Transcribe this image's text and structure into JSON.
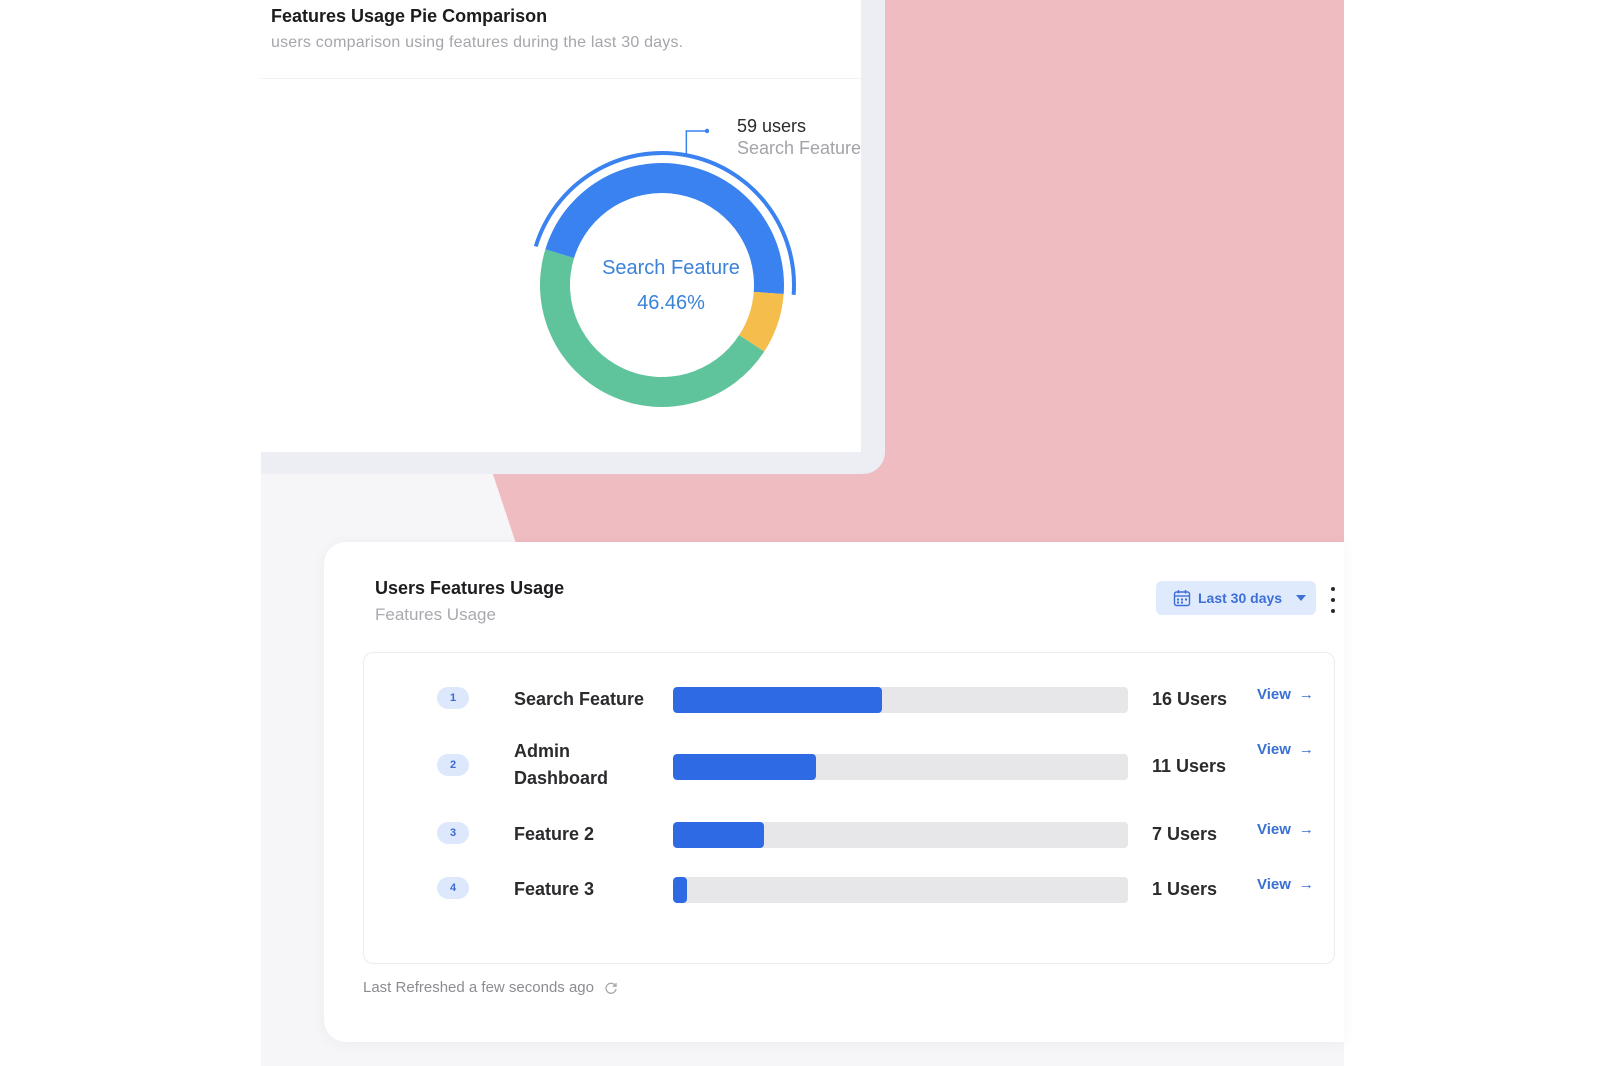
{
  "pie_card": {
    "title": "Features Usage Pie Comparison",
    "subtitle": "users comparison using features during the last 30 days.",
    "callout_value": "59 users",
    "callout_label": "Search Feature",
    "center_name": "Search Feature",
    "center_percent": "46.46%"
  },
  "chart_data": {
    "type": "pie",
    "variant": "donut",
    "highlighted": "Search Feature",
    "slices": [
      {
        "label": "Search Feature",
        "value": 46.46,
        "color": "#3a82f0"
      },
      {
        "label": "",
        "value": 8.0,
        "color": "#f5bd4b"
      },
      {
        "label": "",
        "value": 45.54,
        "color": "#5fc49b"
      }
    ]
  },
  "usage_card": {
    "title": "Users Features Usage",
    "subtitle": "Features Usage",
    "range_label": "Last 30 days",
    "refreshed": "Last Refreshed a few seconds ago",
    "view_label": "View",
    "rows": [
      {
        "rank": "1",
        "name": "Search Feature",
        "count": "16 Users",
        "fraction": 0.46
      },
      {
        "rank": "2",
        "name": "Admin Dashboard",
        "count": "11 Users",
        "fraction": 0.315
      },
      {
        "rank": "3",
        "name": "Feature 2",
        "count": "7 Users",
        "fraction": 0.2
      },
      {
        "rank": "4",
        "name": "Feature 3",
        "count": "1 Users",
        "fraction": 0.03
      }
    ]
  },
  "colors": {
    "accent": "#2f6ae5",
    "backdrop_pink": "#efbcc1"
  },
  "icons": [
    "calendar-icon",
    "caret-down-icon",
    "kebab-menu-icon",
    "arrow-right-icon",
    "refresh-icon"
  ]
}
